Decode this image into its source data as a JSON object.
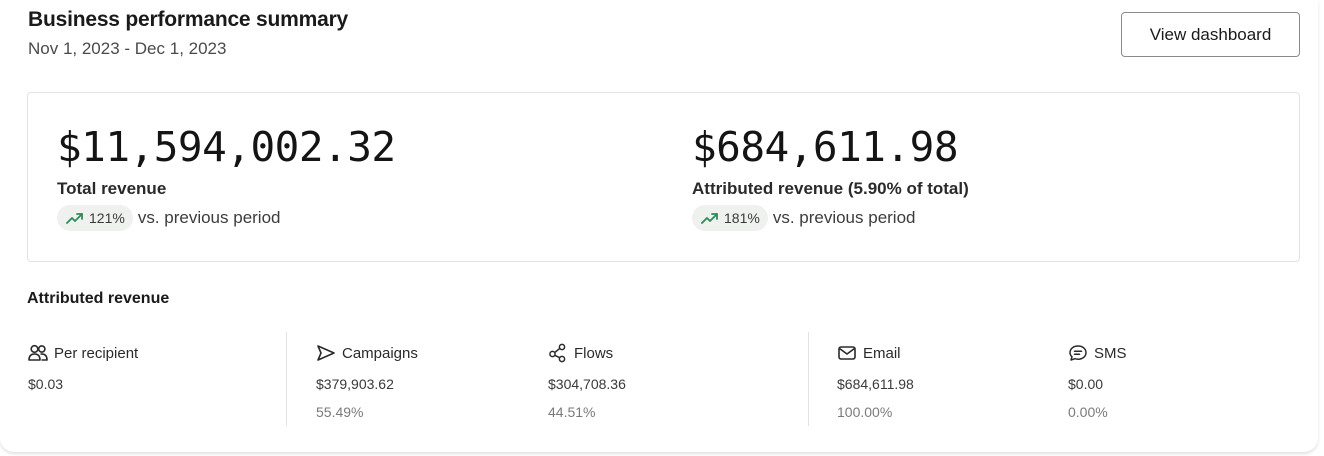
{
  "header": {
    "title": "Business performance summary",
    "date_range": "Nov 1, 2023 - Dec 1, 2023",
    "view_button_label": "View dashboard"
  },
  "kpis": [
    {
      "value": "$11,594,002.32",
      "label": "Total revenue",
      "change_pct": "121%",
      "change_text": "vs. previous period",
      "trend_icon": "trending-up-icon"
    },
    {
      "value": "$684,611.98",
      "label": "Attributed revenue (5.90% of total)",
      "change_pct": "181%",
      "change_text": "vs. previous period",
      "trend_icon": "trending-up-icon"
    }
  ],
  "attributed": {
    "section_title": "Attributed revenue",
    "metrics": [
      {
        "icon": "users-icon",
        "name": "Per recipient",
        "value": "$0.03",
        "pct": ""
      },
      {
        "icon": "send-icon",
        "name": "Campaigns",
        "value": "$379,903.62",
        "pct": "55.49%"
      },
      {
        "icon": "flows-icon",
        "name": "Flows",
        "value": "$304,708.36",
        "pct": "44.51%"
      },
      {
        "icon": "email-icon",
        "name": "Email",
        "value": "$684,611.98",
        "pct": "100.00%"
      },
      {
        "icon": "sms-icon",
        "name": "SMS",
        "value": "$0.00",
        "pct": "0.00%"
      }
    ]
  },
  "colors": {
    "trend_up": "#2e8b57",
    "pill_bg": "#eef1ee",
    "border": "#e3e3e3"
  }
}
